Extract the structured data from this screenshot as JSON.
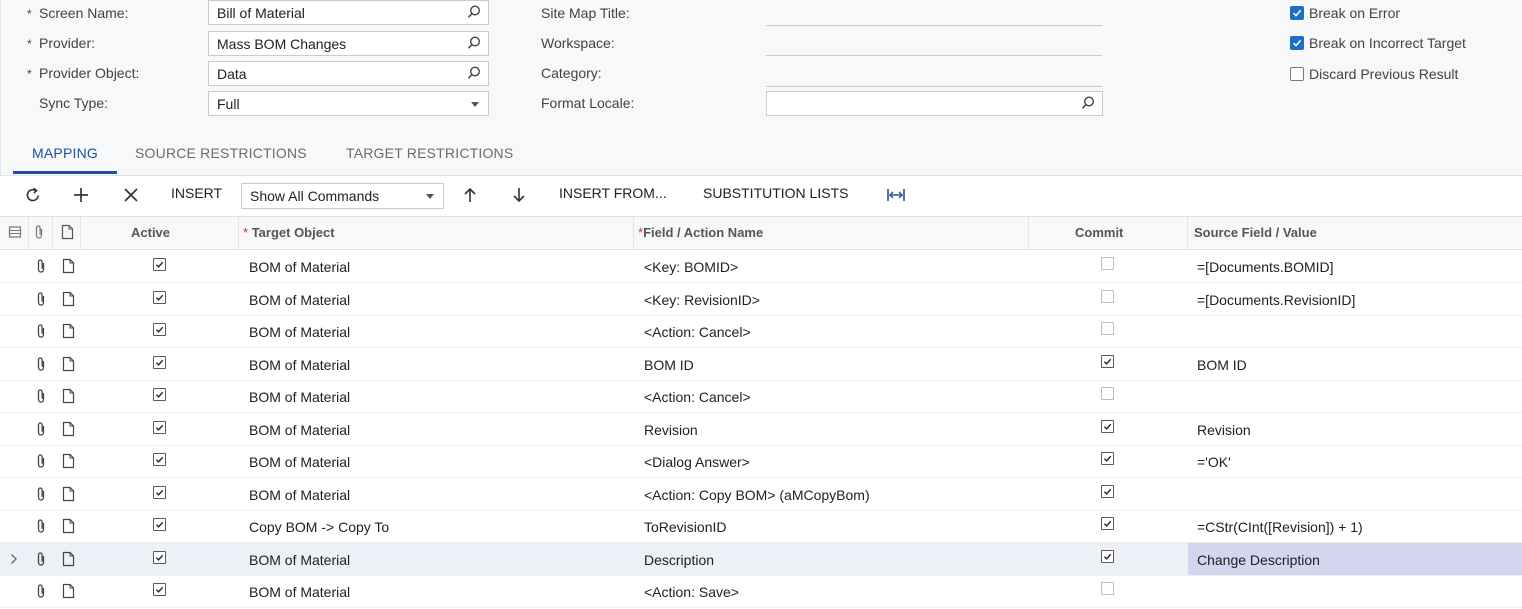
{
  "form": {
    "screen_name_label": "Screen Name:",
    "screen_name_value": "Bill of Material",
    "provider_label": "Provider:",
    "provider_value": "Mass BOM Changes",
    "provider_object_label": "Provider Object:",
    "provider_object_value": "Data",
    "sync_type_label": "Sync Type:",
    "sync_type_value": "Full",
    "site_map_title_label": "Site Map Title:",
    "workspace_label": "Workspace:",
    "category_label": "Category:",
    "format_locale_label": "Format Locale:",
    "required_marker": "*",
    "break_on_error_label": "Break on Error",
    "break_on_error_checked": true,
    "break_on_incorrect_target_label": "Break on Incorrect Target",
    "break_on_incorrect_target_checked": true,
    "discard_previous_result_label": "Discard Previous Result",
    "discard_previous_result_checked": false
  },
  "tabs": [
    "MAPPING",
    "SOURCE RESTRICTIONS",
    "TARGET RESTRICTIONS"
  ],
  "toolbar": {
    "insert_label": "INSERT",
    "commands_select_value": "Show All Commands",
    "insert_from_label": "INSERT FROM...",
    "substitution_lists_label": "SUBSTITUTION LISTS"
  },
  "grid": {
    "headers": {
      "active": "Active",
      "target_object": "Target Object",
      "field_action_name": "Field / Action Name",
      "commit": "Commit",
      "source_field_value": "Source Field / Value"
    },
    "required_marker": "*",
    "rows": [
      {
        "target": "BOM of Material",
        "field": "<Key: BOMID>",
        "commit": false,
        "source": "=[Documents.BOMID]"
      },
      {
        "target": "BOM of Material",
        "field": "<Key: RevisionID>",
        "commit": false,
        "source": "=[Documents.RevisionID]"
      },
      {
        "target": "BOM of Material",
        "field": "<Action: Cancel>",
        "commit": false,
        "source": ""
      },
      {
        "target": "BOM of Material",
        "field": "BOM ID",
        "commit": true,
        "source": "BOM ID"
      },
      {
        "target": "BOM of Material",
        "field": "<Action: Cancel>",
        "commit": false,
        "source": ""
      },
      {
        "target": "BOM of Material",
        "field": "Revision",
        "commit": true,
        "source": "Revision"
      },
      {
        "target": "BOM of Material",
        "field": "<Dialog Answer>",
        "commit": true,
        "source": "='OK'"
      },
      {
        "target": "BOM of Material",
        "field": "<Action: Copy BOM> (aMCopyBom)",
        "commit": true,
        "source": ""
      },
      {
        "target": "Copy BOM -> Copy To",
        "field": "ToRevisionID",
        "commit": true,
        "source": "=CStr(CInt([Revision]) + 1)"
      },
      {
        "target": "BOM of Material",
        "field": "Description",
        "commit": true,
        "source": "Change Description",
        "selected": true
      },
      {
        "target": "BOM of Material",
        "field": "<Action: Save>",
        "commit": false,
        "source": ""
      }
    ]
  },
  "colors": {
    "accent": "#1f4f9e",
    "checkbox_checked": "#1a6fc9",
    "selected_row": "#eef0f8",
    "selected_cell": "#d5d5f0",
    "required_star": "#d32f2f"
  }
}
